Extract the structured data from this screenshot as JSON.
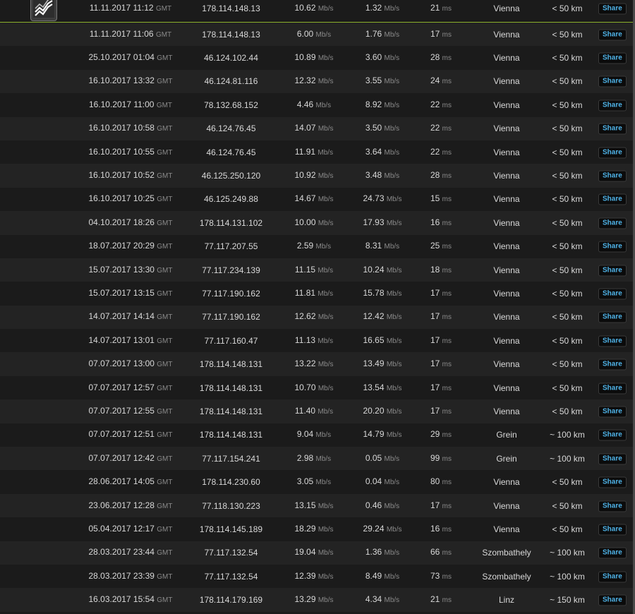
{
  "units": {
    "speed": "Mb/s",
    "ping": "ms",
    "tz": "GMT"
  },
  "share_label": "Share",
  "rows": [
    {
      "date": "11.11.2017 11:12",
      "ip": "178.114.148.13",
      "down": "10.62",
      "up": "1.32",
      "ping": "21",
      "place": "Vienna",
      "dist": "< 50 km"
    },
    {
      "date": "11.11.2017 11:06",
      "ip": "178.114.148.13",
      "down": "6.00",
      "up": "1.76",
      "ping": "17",
      "place": "Vienna",
      "dist": "< 50 km"
    },
    {
      "date": "25.10.2017 01:04",
      "ip": "46.124.102.44",
      "down": "10.89",
      "up": "3.60",
      "ping": "28",
      "place": "Vienna",
      "dist": "< 50 km"
    },
    {
      "date": "16.10.2017 13:32",
      "ip": "46.124.81.116",
      "down": "12.32",
      "up": "3.55",
      "ping": "24",
      "place": "Vienna",
      "dist": "< 50 km"
    },
    {
      "date": "16.10.2017 11:00",
      "ip": "78.132.68.152",
      "down": "4.46",
      "up": "8.92",
      "ping": "22",
      "place": "Vienna",
      "dist": "< 50 km"
    },
    {
      "date": "16.10.2017 10:58",
      "ip": "46.124.76.45",
      "down": "14.07",
      "up": "3.50",
      "ping": "22",
      "place": "Vienna",
      "dist": "< 50 km"
    },
    {
      "date": "16.10.2017 10:55",
      "ip": "46.124.76.45",
      "down": "11.91",
      "up": "3.64",
      "ping": "22",
      "place": "Vienna",
      "dist": "< 50 km"
    },
    {
      "date": "16.10.2017 10:52",
      "ip": "46.125.250.120",
      "down": "10.92",
      "up": "3.48",
      "ping": "28",
      "place": "Vienna",
      "dist": "< 50 km"
    },
    {
      "date": "16.10.2017 10:25",
      "ip": "46.125.249.88",
      "down": "14.67",
      "up": "24.73",
      "ping": "15",
      "place": "Vienna",
      "dist": "< 50 km"
    },
    {
      "date": "04.10.2017 18:26",
      "ip": "178.114.131.102",
      "down": "10.00",
      "up": "17.93",
      "ping": "16",
      "place": "Vienna",
      "dist": "< 50 km"
    },
    {
      "date": "18.07.2017 20:29",
      "ip": "77.117.207.55",
      "down": "2.59",
      "up": "8.31",
      "ping": "25",
      "place": "Vienna",
      "dist": "< 50 km"
    },
    {
      "date": "15.07.2017 13:30",
      "ip": "77.117.234.139",
      "down": "11.15",
      "up": "10.24",
      "ping": "18",
      "place": "Vienna",
      "dist": "< 50 km"
    },
    {
      "date": "15.07.2017 13:15",
      "ip": "77.117.190.162",
      "down": "11.81",
      "up": "15.78",
      "ping": "17",
      "place": "Vienna",
      "dist": "< 50 km"
    },
    {
      "date": "14.07.2017 14:14",
      "ip": "77.117.190.162",
      "down": "12.62",
      "up": "12.42",
      "ping": "17",
      "place": "Vienna",
      "dist": "< 50 km"
    },
    {
      "date": "14.07.2017 13:01",
      "ip": "77.117.160.47",
      "down": "11.13",
      "up": "16.65",
      "ping": "17",
      "place": "Vienna",
      "dist": "< 50 km"
    },
    {
      "date": "07.07.2017 13:00",
      "ip": "178.114.148.131",
      "down": "13.22",
      "up": "13.49",
      "ping": "17",
      "place": "Vienna",
      "dist": "< 50 km"
    },
    {
      "date": "07.07.2017 12:57",
      "ip": "178.114.148.131",
      "down": "10.70",
      "up": "13.54",
      "ping": "17",
      "place": "Vienna",
      "dist": "< 50 km"
    },
    {
      "date": "07.07.2017 12:55",
      "ip": "178.114.148.131",
      "down": "11.40",
      "up": "20.20",
      "ping": "17",
      "place": "Vienna",
      "dist": "< 50 km"
    },
    {
      "date": "07.07.2017 12:51",
      "ip": "178.114.148.131",
      "down": "9.04",
      "up": "14.79",
      "ping": "29",
      "place": "Grein",
      "dist": "~ 100 km"
    },
    {
      "date": "07.07.2017 12:42",
      "ip": "77.117.154.241",
      "down": "2.98",
      "up": "0.05",
      "ping": "99",
      "place": "Grein",
      "dist": "~ 100 km"
    },
    {
      "date": "28.06.2017 14:05",
      "ip": "178.114.230.60",
      "down": "3.05",
      "up": "0.04",
      "ping": "80",
      "place": "Vienna",
      "dist": "< 50 km"
    },
    {
      "date": "23.06.2017 12:28",
      "ip": "77.118.130.223",
      "down": "13.15",
      "up": "0.46",
      "ping": "17",
      "place": "Vienna",
      "dist": "< 50 km"
    },
    {
      "date": "05.04.2017 12:17",
      "ip": "178.114.145.189",
      "down": "18.29",
      "up": "29.24",
      "ping": "16",
      "place": "Vienna",
      "dist": "< 50 km"
    },
    {
      "date": "28.03.2017 23:44",
      "ip": "77.117.132.54",
      "down": "19.04",
      "up": "1.36",
      "ping": "66",
      "place": "Szombathely",
      "dist": "~ 100 km"
    },
    {
      "date": "28.03.2017 23:39",
      "ip": "77.117.132.54",
      "down": "12.39",
      "up": "8.49",
      "ping": "73",
      "place": "Szombathely",
      "dist": "~ 100 km"
    },
    {
      "date": "16.03.2017 15:54",
      "ip": "178.114.179.169",
      "down": "13.29",
      "up": "4.34",
      "ping": "21",
      "place": "Linz",
      "dist": "~ 150 km"
    }
  ],
  "badge_icon": "network-graph-icon",
  "colors": {
    "accent_border": "#8ab02a",
    "share_text": "#4fb3e8"
  }
}
